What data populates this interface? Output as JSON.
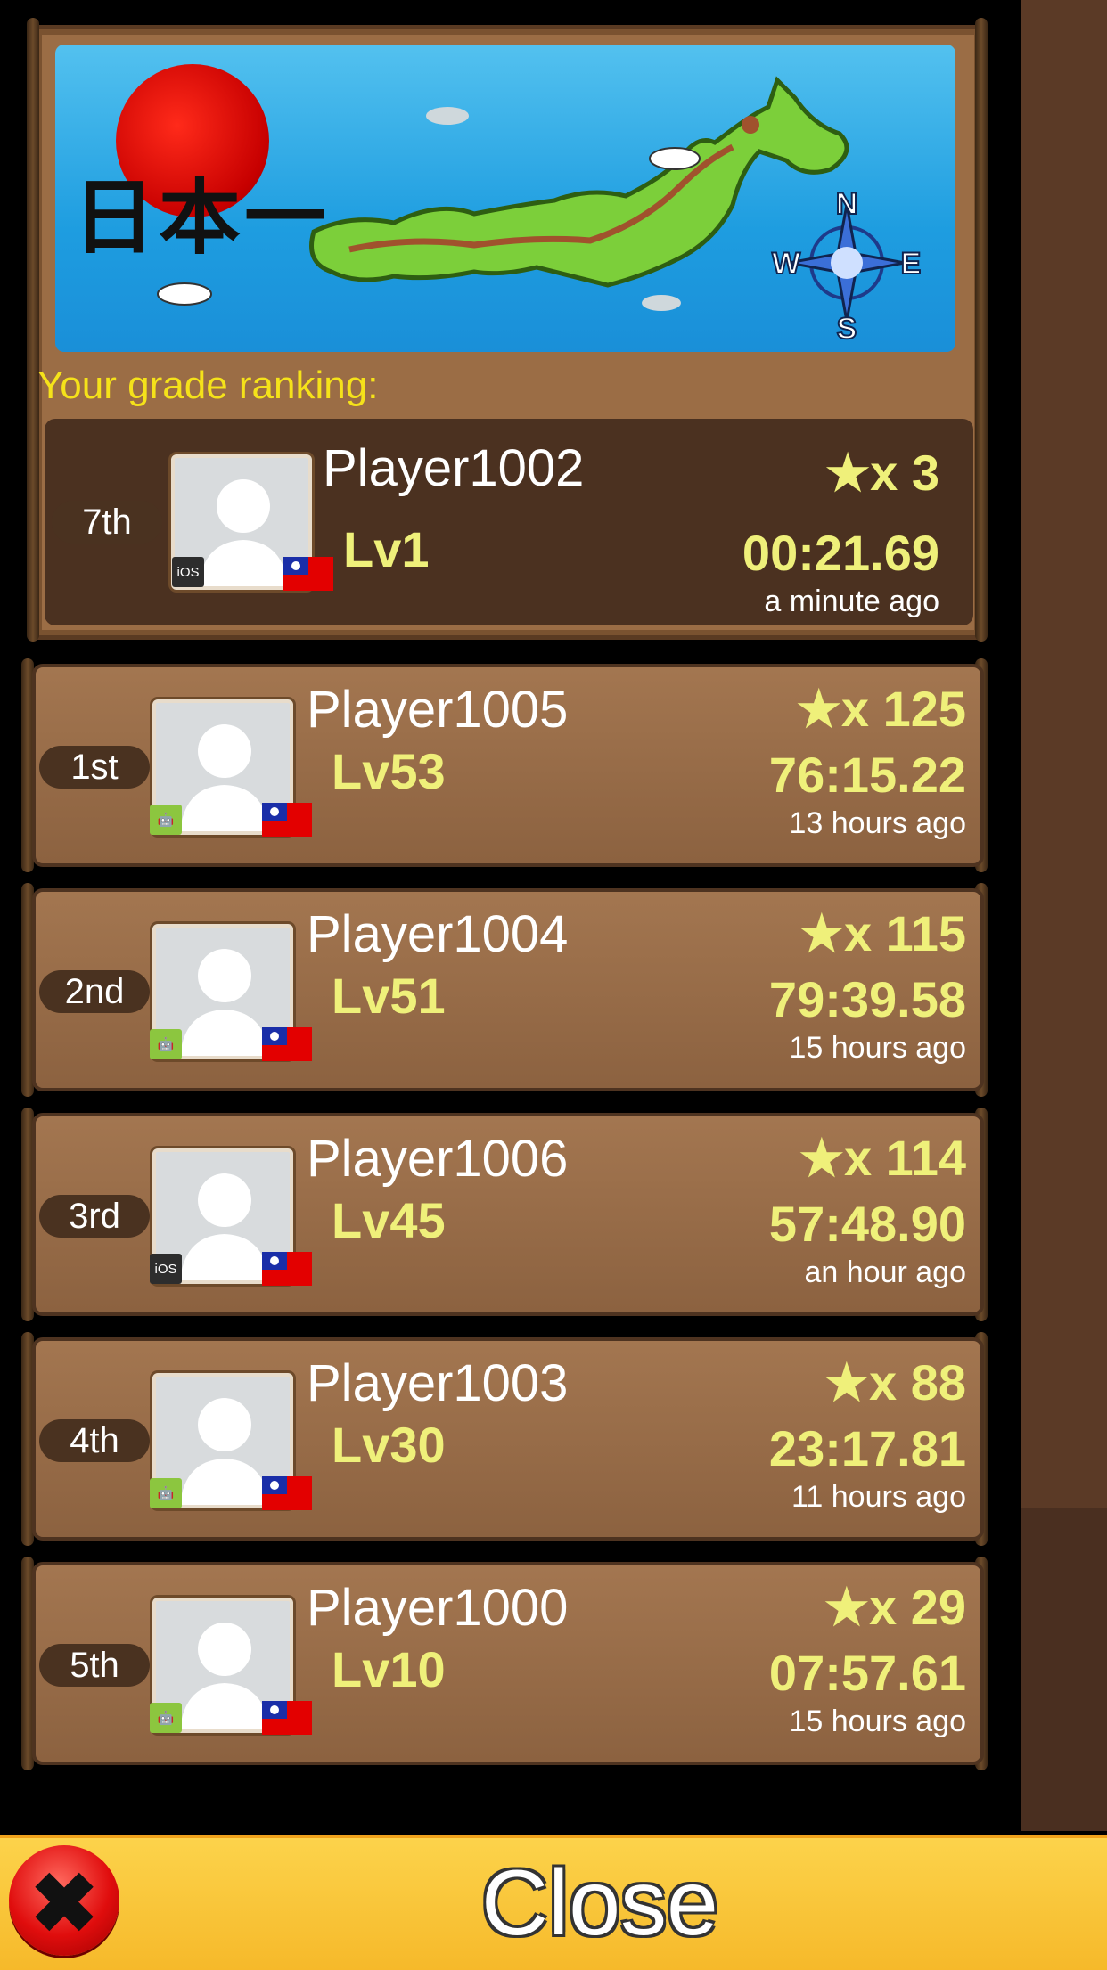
{
  "banner": {
    "title_kanji": "日本一"
  },
  "your_ranking": {
    "heading": "Your grade ranking:",
    "player": {
      "rank": "7th",
      "name": "Player1002",
      "level": "Lv1",
      "stars": "★x 3",
      "time": "00:21.69",
      "ago": "a minute ago",
      "platform": "iOS"
    }
  },
  "leaderboard": [
    {
      "rank": "1st",
      "name": "Player1005",
      "level": "Lv53",
      "stars": "★x 125",
      "time": "76:15.22",
      "ago": "13 hours ago",
      "platform": "android"
    },
    {
      "rank": "2nd",
      "name": "Player1004",
      "level": "Lv51",
      "stars": "★x 115",
      "time": "79:39.58",
      "ago": "15 hours ago",
      "platform": "android"
    },
    {
      "rank": "3rd",
      "name": "Player1006",
      "level": "Lv45",
      "stars": "★x 114",
      "time": "57:48.90",
      "ago": "an hour ago",
      "platform": "iOS"
    },
    {
      "rank": "4th",
      "name": "Player1003",
      "level": "Lv30",
      "stars": "★x 88",
      "time": "23:17.81",
      "ago": "11 hours ago",
      "platform": "android"
    },
    {
      "rank": "5th",
      "name": "Player1000",
      "level": "Lv10",
      "stars": "★x 29",
      "time": "07:57.61",
      "ago": "15 hours ago",
      "platform": "android"
    }
  ],
  "close_button": {
    "label": "Close"
  },
  "colors": {
    "wood": "#9b6d45",
    "dark_wood": "#4a3220",
    "accent_yellow": "#eff07a",
    "close_bar": "#f9c93a"
  }
}
